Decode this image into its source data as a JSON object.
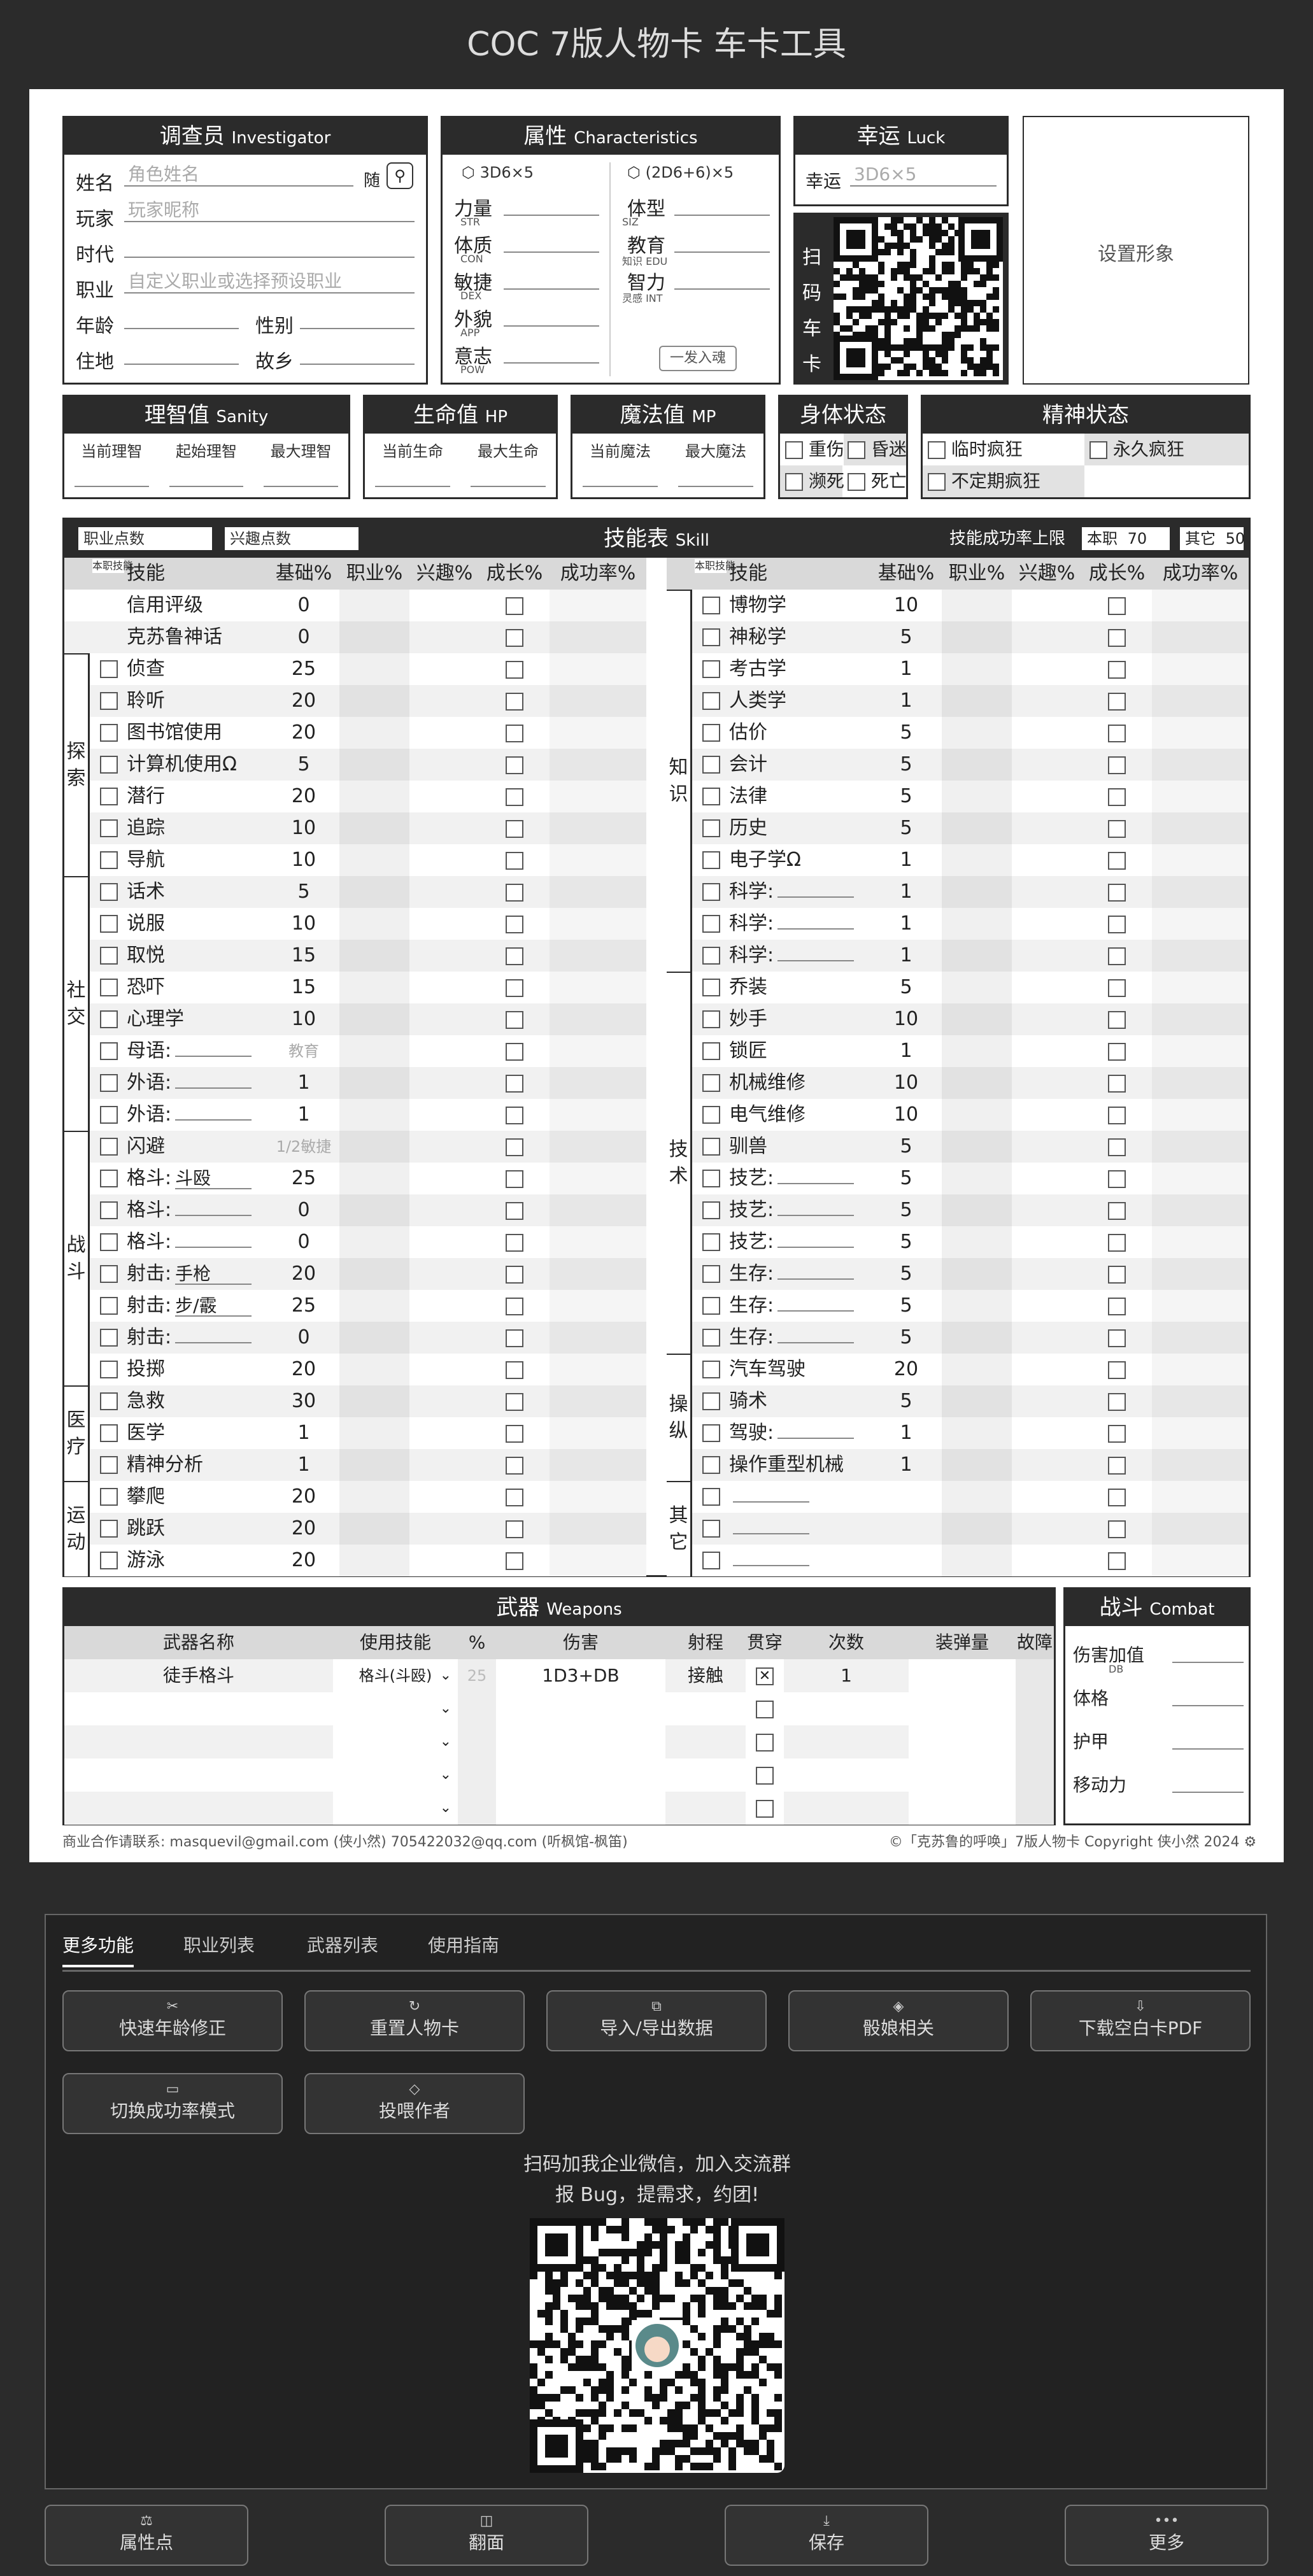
{
  "app_title": "COC 7版人物卡 车卡工具",
  "investigator": {
    "title": "调查员",
    "title_en": "Investigator",
    "name_label": "姓名",
    "name_placeholder": "角色姓名",
    "random_label": "随",
    "player_label": "玩家",
    "player_placeholder": "玩家昵称",
    "era_label": "时代",
    "occupation_label": "职业",
    "occupation_placeholder": "自定义职业或选择预设职业",
    "age_label": "年龄",
    "gender_label": "性别",
    "residence_label": "住地",
    "hometown_label": "故乡"
  },
  "characteristics": {
    "title": "属性",
    "title_en": "Characteristics",
    "dice_left": "3D6×5",
    "dice_right": "(2D6+6)×5",
    "one_click": "一发入魂",
    "left": [
      {
        "name": "力量",
        "abbr": "STR"
      },
      {
        "name": "体质",
        "abbr": "CON"
      },
      {
        "name": "敏捷",
        "abbr": "DEX"
      },
      {
        "name": "外貌",
        "abbr": "APP"
      },
      {
        "name": "意志",
        "abbr": "POW"
      }
    ],
    "right": [
      {
        "name": "体型",
        "abbr": "SIZ"
      },
      {
        "name": "教育",
        "abbr": "知识 EDU"
      },
      {
        "name": "智力",
        "abbr": "灵感 INT"
      }
    ]
  },
  "luck": {
    "title": "幸运",
    "title_en": "Luck",
    "label": "幸运",
    "placeholder": "3D6×5"
  },
  "scan": {
    "label": [
      "扫",
      "码",
      "车",
      "卡"
    ]
  },
  "portrait": {
    "label": "设置形象"
  },
  "sanity": {
    "title": "理智值",
    "title_en": "Sanity",
    "cols": [
      "当前理智",
      "起始理智",
      "最大理智"
    ]
  },
  "hp": {
    "title": "生命值",
    "title_en": "HP",
    "cols": [
      "当前生命",
      "最大生命"
    ]
  },
  "mp": {
    "title": "魔法值",
    "title_en": "MP",
    "cols": [
      "当前魔法",
      "最大魔法"
    ]
  },
  "body_status": {
    "title": "身体状态",
    "items": [
      "重伤",
      "昏迷",
      "濒死",
      "死亡"
    ]
  },
  "mind_status": {
    "title": "精神状态",
    "items": [
      "临时疯狂",
      "永久疯狂",
      "不定期疯狂"
    ]
  },
  "skills": {
    "title": "技能表",
    "title_en": "Skill",
    "occ_points": "职业点数",
    "int_points": "兴趣点数",
    "limit_label": "技能成功率上限",
    "occ_label": "本职",
    "occ_limit": "70",
    "other_label": "其它",
    "other_limit": "50",
    "headers": {
      "occ": "本职技能",
      "skill": "技能",
      "base": "基础%",
      "occupation": "职业%",
      "interest": "兴趣%",
      "growth": "成长%",
      "success": "成功率%"
    },
    "left": [
      {
        "name": "信用评级",
        "base": "0",
        "nocb": true
      },
      {
        "name": "克苏鲁神话",
        "base": "0",
        "nocb": true
      },
      {
        "name": "侦查",
        "base": "25"
      },
      {
        "name": "聆听",
        "base": "20"
      },
      {
        "name": "图书馆使用",
        "base": "20"
      },
      {
        "name": "计算机使用Ω",
        "base": "5"
      },
      {
        "name": "潜行",
        "base": "20"
      },
      {
        "name": "追踪",
        "base": "10"
      },
      {
        "name": "导航",
        "base": "10"
      },
      {
        "name": "话术",
        "base": "5"
      },
      {
        "name": "说服",
        "base": "10"
      },
      {
        "name": "取悦",
        "base": "15"
      },
      {
        "name": "恐吓",
        "base": "15"
      },
      {
        "name": "心理学",
        "base": "10"
      },
      {
        "name": "母语:",
        "fill": "",
        "base": "教育",
        "muted": true
      },
      {
        "name": "外语:",
        "fill": "",
        "base": "1"
      },
      {
        "name": "外语:",
        "fill": "",
        "base": "1"
      },
      {
        "name": "闪避",
        "base": "1/2敏捷",
        "muted": true
      },
      {
        "name": "格斗:",
        "fill": "斗殴",
        "base": "25"
      },
      {
        "name": "格斗:",
        "fill": "",
        "base": "0"
      },
      {
        "name": "格斗:",
        "fill": "",
        "base": "0"
      },
      {
        "name": "射击:",
        "fill": "手枪",
        "base": "20"
      },
      {
        "name": "射击:",
        "fill": "步/霰",
        "base": "25"
      },
      {
        "name": "射击:",
        "fill": "",
        "base": "0"
      },
      {
        "name": "投掷",
        "base": "20"
      },
      {
        "name": "急救",
        "base": "30"
      },
      {
        "name": "医学",
        "base": "1"
      },
      {
        "name": "精神分析",
        "base": "1"
      },
      {
        "name": "攀爬",
        "base": "20"
      },
      {
        "name": "跳跃",
        "base": "20"
      },
      {
        "name": "游泳",
        "base": "20"
      }
    ],
    "left_groups": [
      {
        "label": "探索",
        "start": 2,
        "count": 7
      },
      {
        "label": "社交",
        "start": 9,
        "count": 8
      },
      {
        "label": "战斗",
        "start": 17,
        "count": 8
      },
      {
        "label": "医疗",
        "start": 25,
        "count": 3
      },
      {
        "label": "运动",
        "start": 28,
        "count": 3
      }
    ],
    "right": [
      {
        "name": "博物学",
        "base": "10"
      },
      {
        "name": "神秘学",
        "base": "5"
      },
      {
        "name": "考古学",
        "base": "1"
      },
      {
        "name": "人类学",
        "base": "1"
      },
      {
        "name": "估价",
        "base": "5"
      },
      {
        "name": "会计",
        "base": "5"
      },
      {
        "name": "法律",
        "base": "5"
      },
      {
        "name": "历史",
        "base": "5"
      },
      {
        "name": "电子学Ω",
        "base": "1"
      },
      {
        "name": "科学:",
        "fill": "",
        "base": "1"
      },
      {
        "name": "科学:",
        "fill": "",
        "base": "1"
      },
      {
        "name": "科学:",
        "fill": "",
        "base": "1"
      },
      {
        "name": "乔装",
        "base": "5"
      },
      {
        "name": "妙手",
        "base": "10"
      },
      {
        "name": "锁匠",
        "base": "1"
      },
      {
        "name": "机械维修",
        "base": "10"
      },
      {
        "name": "电气维修",
        "base": "10"
      },
      {
        "name": "驯兽",
        "base": "5"
      },
      {
        "name": "技艺:",
        "fill": "",
        "base": "5"
      },
      {
        "name": "技艺:",
        "fill": "",
        "base": "5"
      },
      {
        "name": "技艺:",
        "fill": "",
        "base": "5"
      },
      {
        "name": "生存:",
        "fill": "",
        "base": "5"
      },
      {
        "name": "生存:",
        "fill": "",
        "base": "5"
      },
      {
        "name": "生存:",
        "fill": "",
        "base": "5"
      },
      {
        "name": "汽车驾驶",
        "base": "20"
      },
      {
        "name": "骑术",
        "base": "5"
      },
      {
        "name": "驾驶:",
        "fill": "",
        "base": "1"
      },
      {
        "name": "操作重型机械",
        "base": "1"
      },
      {
        "name": "",
        "fill": "",
        "base": ""
      },
      {
        "name": "",
        "fill": "",
        "base": ""
      },
      {
        "name": "",
        "fill": "",
        "base": ""
      }
    ],
    "right_groups": [
      {
        "label": "知识",
        "start": 0,
        "count": 12
      },
      {
        "label": "技术",
        "start": 12,
        "count": 12
      },
      {
        "label": "操纵",
        "start": 24,
        "count": 4
      },
      {
        "label": "其它",
        "start": 28,
        "count": 3
      }
    ]
  },
  "weapons": {
    "title": "武器",
    "title_en": "Weapons",
    "headers": [
      "武器名称",
      "使用技能",
      "%",
      "伤害",
      "射程",
      "贯穿",
      "次数",
      "装弹量",
      "故障"
    ],
    "rows": [
      {
        "name": "徒手格斗",
        "skill": "格斗(斗殴)",
        "pct": "25",
        "damage": "1D3+DB",
        "range": "接触",
        "impale": true,
        "times": "1"
      },
      {},
      {},
      {},
      {}
    ]
  },
  "combat": {
    "title": "战斗",
    "title_en": "Combat",
    "items": [
      {
        "label": "伤害加值",
        "sub": "DB"
      },
      {
        "label": "体格",
        "sub": ""
      },
      {
        "label": "护甲",
        "sub": ""
      },
      {
        "label": "移动力",
        "sub": ""
      }
    ]
  },
  "footer": {
    "left": "商业合作请联系: masquevil@gmail.com (侠小然) 705422032@qq.com (听枫馆-枫笛)",
    "right": "©「克苏鲁的呼唤」7版人物卡 Copyright 侠小然 2024"
  },
  "more": {
    "tabs": [
      "更多功能",
      "职业列表",
      "武器列表",
      "使用指南"
    ],
    "buttons": [
      {
        "icon": "✂",
        "label": "快速年龄修正"
      },
      {
        "icon": "↻",
        "label": "重置人物卡"
      },
      {
        "icon": "⧉",
        "label": "导入/导出数据"
      },
      {
        "icon": "◈",
        "label": "骰娘相关"
      },
      {
        "icon": "⇩",
        "label": "下载空白卡PDF"
      },
      {
        "icon": "▭",
        "label": "切换成功率模式"
      },
      {
        "icon": "◇",
        "label": "投喂作者"
      }
    ],
    "qr_line1": "扫码加我企业微信，加入交流群",
    "qr_line2": "报 Bug，提需求，约团!"
  },
  "bottom_nav": [
    {
      "icon": "⚖",
      "label": "属性点"
    },
    {
      "icon": "◫",
      "label": "翻面"
    },
    {
      "icon": "⤓",
      "label": "保存"
    },
    {
      "icon": "•••",
      "label": "更多"
    }
  ]
}
